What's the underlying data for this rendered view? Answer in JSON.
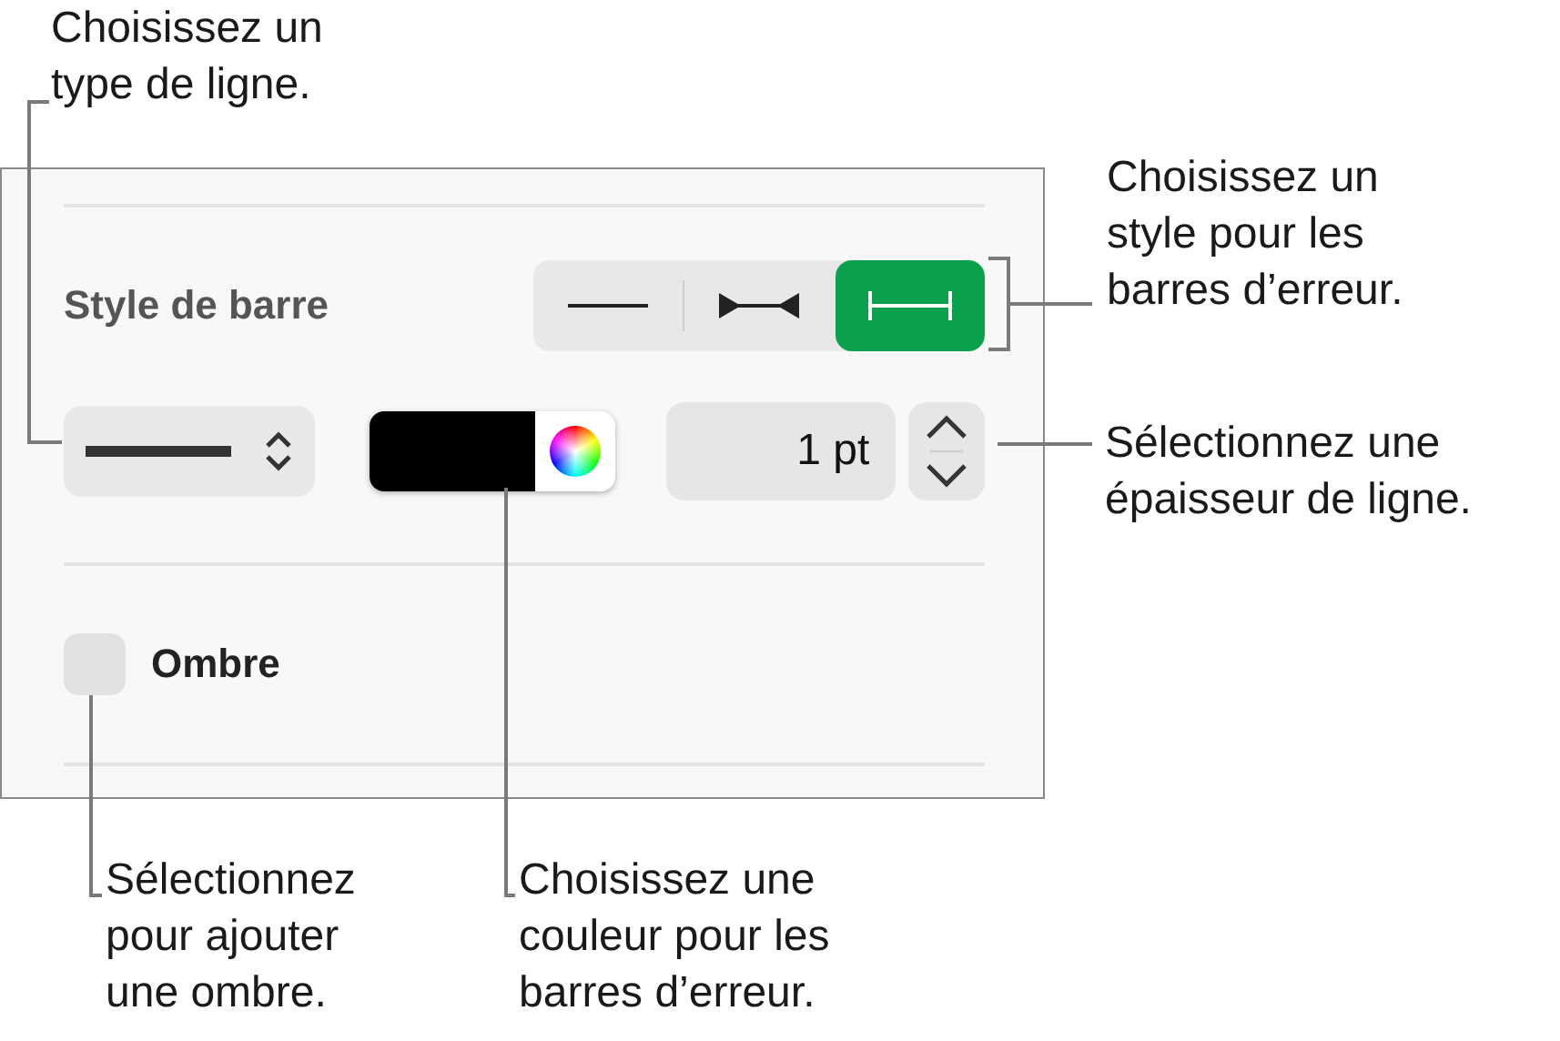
{
  "panel": {
    "bar_style": {
      "label": "Style de barre",
      "segments": [
        {
          "kind": "plain",
          "selected": false
        },
        {
          "kind": "arrow",
          "selected": false
        },
        {
          "kind": "cap",
          "selected": true
        }
      ]
    },
    "thickness": "1 pt",
    "shadow": {
      "label": "Ombre",
      "checked": false
    }
  },
  "callouts": [
    {
      "kind": "line-type",
      "text": "Choisissez un\ntype de ligne."
    },
    {
      "kind": "bar-style",
      "text": "Choisissez un\nstyle pour les\nbarres d’erreur."
    },
    {
      "kind": "thickness",
      "text": "Sélectionnez une\népaisseur de ligne."
    },
    {
      "kind": "shadow",
      "text": "Sélectionnez\npour ajouter\nune ombre."
    },
    {
      "kind": "color",
      "text": "Choisissez une\ncouleur pour les\nbarres d’erreur."
    }
  ]
}
